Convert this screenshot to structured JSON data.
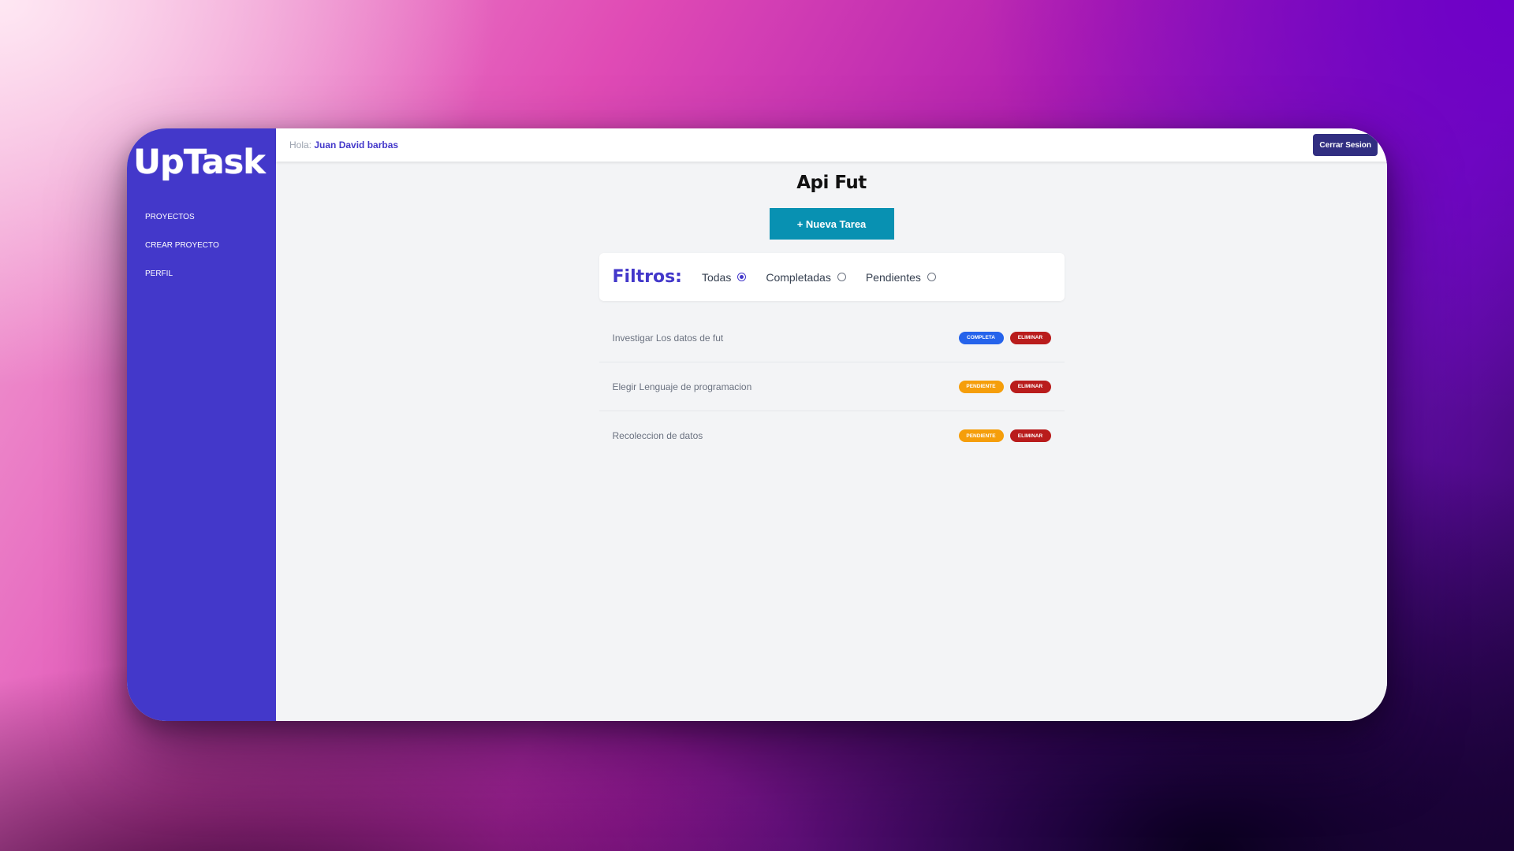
{
  "app": {
    "logo": "UpTask"
  },
  "sidebar": {
    "items": [
      {
        "label": "Proyectos"
      },
      {
        "label": "Crear Proyecto"
      },
      {
        "label": "Perfil"
      }
    ]
  },
  "header": {
    "greeting_prefix": "Hola:",
    "user_name": "Juan David barbas",
    "logout_label": "Cerrar Sesion"
  },
  "project": {
    "title": "Api Fut",
    "new_task_label": "+ Nueva Tarea"
  },
  "filters": {
    "label": "Filtros:",
    "options": [
      {
        "label": "Todas",
        "checked": true
      },
      {
        "label": "Completadas",
        "checked": false
      },
      {
        "label": "Pendientes",
        "checked": false
      }
    ]
  },
  "tasks": [
    {
      "name": "Investigar Los datos de fut",
      "status_label": "Completa",
      "status_color": "#2563eb",
      "delete_label": "Eliminar"
    },
    {
      "name": "Elegir Lenguaje de programacion",
      "status_label": "Pendiente",
      "status_color": "#f59e0b",
      "delete_label": "Eliminar"
    },
    {
      "name": "Recoleccion de datos",
      "status_label": "Pendiente",
      "status_color": "#f59e0b",
      "delete_label": "Eliminar"
    }
  ],
  "colors": {
    "brand": "#4338ca",
    "logout_bg": "#312e81",
    "new_task_bg": "#0891b2",
    "delete_bg": "#b91c1c"
  }
}
